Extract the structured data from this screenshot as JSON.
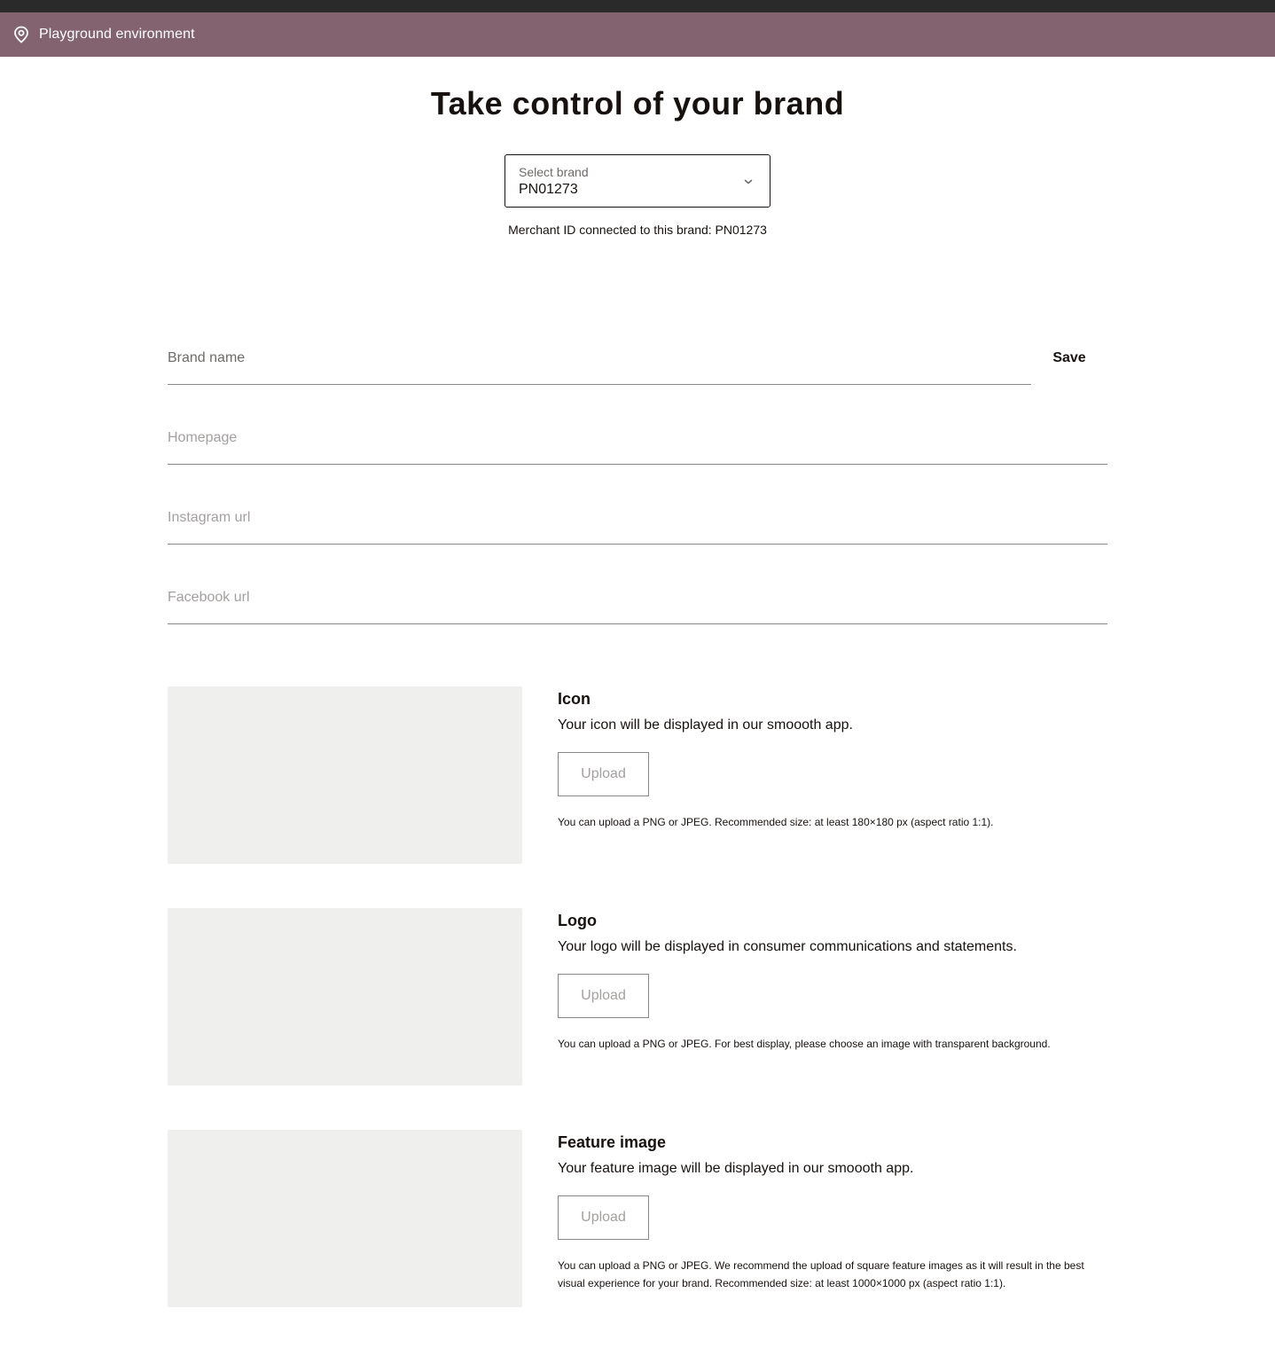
{
  "environment": {
    "label": "Playground environment",
    "icon": "location-pin-icon"
  },
  "page": {
    "title": "Take control of your brand"
  },
  "brand_select": {
    "label": "Select brand",
    "value": "PN01273",
    "icon": "chevron-down-icon"
  },
  "merchant_note": "Merchant ID connected to this brand: PN01273",
  "form": {
    "brand_name_placeholder": "Brand name",
    "save_label": "Save",
    "homepage_placeholder": "Homepage",
    "instagram_placeholder": "Instagram url",
    "facebook_placeholder": "Facebook url"
  },
  "assets": [
    {
      "title": "Icon",
      "description": "Your icon will be displayed in our smoooth app.",
      "upload_label": "Upload",
      "help": "You can upload a PNG or JPEG. Recommended size: at least 180×180 px (aspect ratio 1:1)."
    },
    {
      "title": "Logo",
      "description": "Your logo will be displayed in consumer communications and statements.",
      "upload_label": "Upload",
      "help": "You can upload a PNG or JPEG. For best display, please choose an image with transparent background."
    },
    {
      "title": "Feature image",
      "description": "Your feature image will be displayed in our smoooth app.",
      "upload_label": "Upload",
      "help": "You can upload a PNG or JPEG. We recommend the upload of square feature images as it will result in the best visual experience for your brand. Recommended size: at least 1000×1000 px (aspect ratio 1:1)."
    }
  ],
  "colors": {
    "env_bar": "#836370",
    "top_bar": "#2a2a2a",
    "text": "#17120f",
    "preview_bg": "#efefed"
  }
}
